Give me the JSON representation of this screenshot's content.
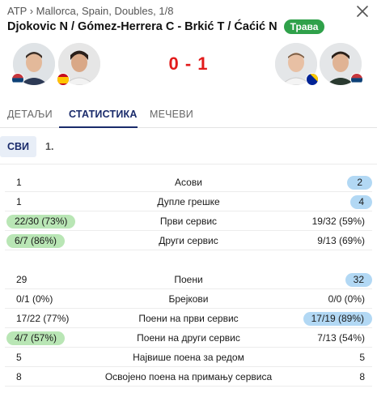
{
  "header": {
    "breadcrumb": "ATP › Mallorca, Spain, Doubles, 1/8",
    "title": "Djokovic N / Gómez-Herrera C - Brkić T / Ćaćić N",
    "surface": "Трава",
    "score": "0 - 1",
    "colors": {
      "surface": "#2fa14a",
      "score": "#e21b1b",
      "accent": "#1a2b6b"
    }
  },
  "players": [
    {
      "flag": "serbia"
    },
    {
      "flag": "spain"
    },
    {
      "flag": "bosnia"
    },
    {
      "flag": "serbia"
    }
  ],
  "tabs": [
    "ДЕТАЉИ",
    "СТАТИСТИКА",
    "МЕЧЕВИ"
  ],
  "active_tab": "СТАТИСТИКА",
  "subtabs": [
    "СВИ",
    "1."
  ],
  "active_subtab": "СВИ",
  "stats_group1": [
    {
      "label": "Асови",
      "left": "1",
      "right": "2",
      "highlight": "right"
    },
    {
      "label": "Дупле грешке",
      "left": "1",
      "right": "4",
      "highlight": "right"
    },
    {
      "label": "Први сервис",
      "left": "22/30 (73%)",
      "right": "19/32 (59%)",
      "highlight": "left"
    },
    {
      "label": "Други сервис",
      "left": "6/7 (86%)",
      "right": "9/13 (69%)",
      "highlight": "left"
    }
  ],
  "stats_group2": [
    {
      "label": "Поени",
      "left": "29",
      "right": "32",
      "highlight": "right"
    },
    {
      "label": "Брејкови",
      "left": "0/1 (0%)",
      "right": "0/0 (0%)",
      "highlight": "none"
    },
    {
      "label": "Поени на први сервис",
      "left": "17/22 (77%)",
      "right": "17/19 (89%)",
      "highlight": "right"
    },
    {
      "label": "Поени на други сервис",
      "left": "4/7 (57%)",
      "right": "7/13 (54%)",
      "highlight": "left"
    },
    {
      "label": "Највише поена за редом",
      "left": "5",
      "right": "5",
      "highlight": "none"
    },
    {
      "label": "Освојено поена на примању сервиса",
      "left": "8",
      "right": "8",
      "highlight": "none"
    }
  ]
}
